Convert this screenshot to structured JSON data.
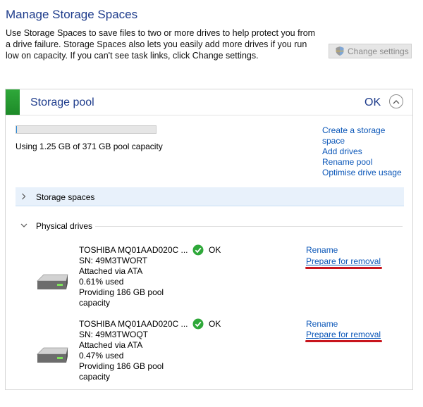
{
  "page": {
    "title": "Manage Storage Spaces",
    "description": "Use Storage Spaces to save files to two or more drives to help protect you from a drive failure. Storage Spaces also lets you easily add more drives if you run low on capacity. If you can't see task links, click Change settings.",
    "change_settings_label": "Change settings"
  },
  "pool": {
    "title": "Storage pool",
    "status": "OK",
    "used_fraction": 0.0034,
    "usage_text": "Using 1.25 GB of 371 GB pool capacity",
    "links": [
      "Create a storage space",
      "Add drives",
      "Rename pool",
      "Optimise drive usage"
    ]
  },
  "sections": {
    "storage_spaces": "Storage spaces",
    "physical_drives": "Physical drives"
  },
  "drives": [
    {
      "name": "TOSHIBA MQ01AAD020C ...",
      "sn": "SN: 49M3TWORT",
      "attached": "Attached via ATA",
      "used": "0.61% used",
      "providing_1": "Providing 186 GB pool",
      "providing_2": "capacity",
      "status": "OK",
      "rename": "Rename",
      "prepare": "Prepare for removal"
    },
    {
      "name": "TOSHIBA MQ01AAD020C ...",
      "sn": "SN: 49M3TWOQT",
      "attached": "Attached via ATA",
      "used": "0.47% used",
      "providing_1": "Providing 186 GB pool",
      "providing_2": "capacity",
      "status": "OK",
      "rename": "Rename",
      "prepare": "Prepare for removal"
    }
  ],
  "colors": {
    "title_blue": "#1e3c8c",
    "link_blue": "#0a56b8",
    "ok_green": "#2fa83a",
    "annotation_red": "#c8151d"
  }
}
